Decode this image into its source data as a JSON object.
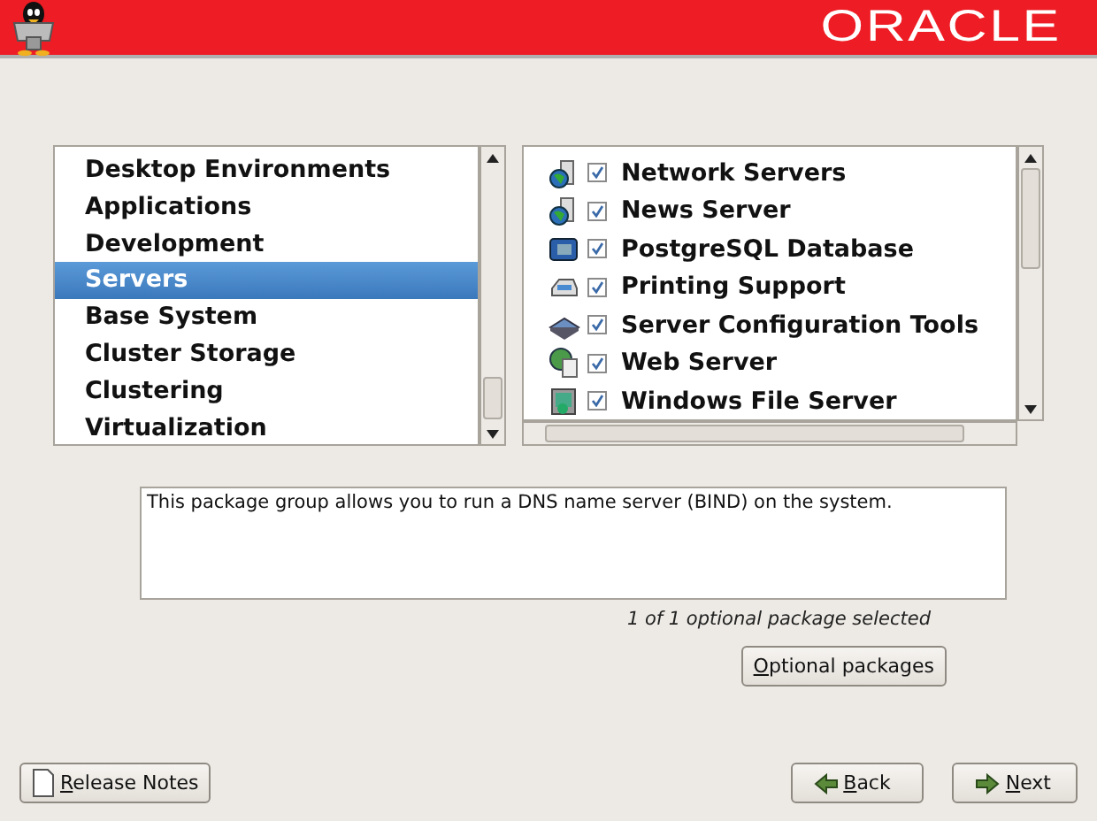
{
  "header": {
    "logo": "ORACLE"
  },
  "groups": [
    {
      "label": "Desktop Environments",
      "selected": false
    },
    {
      "label": "Applications",
      "selected": false
    },
    {
      "label": "Development",
      "selected": false
    },
    {
      "label": "Servers",
      "selected": true
    },
    {
      "label": "Base System",
      "selected": false
    },
    {
      "label": "Cluster Storage",
      "selected": false
    },
    {
      "label": "Clustering",
      "selected": false
    },
    {
      "label": "Virtualization",
      "selected": false
    }
  ],
  "packages": [
    {
      "label": "Network Servers",
      "checked": true
    },
    {
      "label": "News Server",
      "checked": true
    },
    {
      "label": "PostgreSQL Database",
      "checked": true
    },
    {
      "label": "Printing Support",
      "checked": true
    },
    {
      "label": "Server Configuration Tools",
      "checked": true
    },
    {
      "label": "Web Server",
      "checked": true
    },
    {
      "label": "Windows File Server",
      "checked": true
    }
  ],
  "description": "This package group allows you to run a DNS name server (BIND) on the system.",
  "optional_status": "1 of 1 optional package selected",
  "optional_button": "Optional packages",
  "buttons": {
    "release_notes": "Release Notes",
    "back": "Back",
    "next": "Next"
  }
}
